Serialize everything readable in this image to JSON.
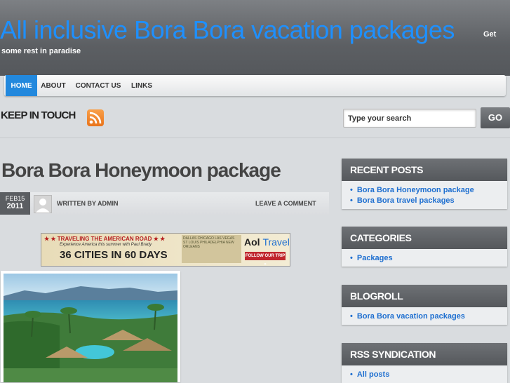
{
  "header": {
    "site_title": "All inclusive Bora Bora vacation packages",
    "tagline_part1": "Get",
    "tagline_part2": "some rest in paradise"
  },
  "nav": {
    "items": [
      {
        "label": "HOME",
        "active": true
      },
      {
        "label": "ABOUT",
        "active": false
      },
      {
        "label": "CONTACT US",
        "active": false
      },
      {
        "label": "LINKS",
        "active": false
      }
    ]
  },
  "keep_in_touch": {
    "label": "KEEP IN TOUCH",
    "search_placeholder": "Type your search",
    "go_label": "GO"
  },
  "post": {
    "title": "Bora Bora Honeymoon package",
    "date_month_day": "FEB15",
    "date_year": "2011",
    "written_by": "WRITTEN BY",
    "author": "ADMIN",
    "leave_comment": "LEAVE A COMMENT"
  },
  "ad": {
    "headline": "TRAVELING THE AMERICAN ROAD",
    "subline": "Experience America this summer with Paul Brady",
    "cities_line": "36 CITIES IN 60 DAYS",
    "map_cities": "DALLAS CHICAGO LAS VEGAS ST LOUIS PHILADELPHIA NEW ORLEANS",
    "brand": "Aol",
    "brand_suffix": "Travel.",
    "cta": "FOLLOW OUR TRIP »"
  },
  "sidebar": {
    "recent_posts": {
      "title": "RECENT POSTS",
      "items": [
        "Bora Bora Honeymoon package",
        "Bora Bora travel packages"
      ]
    },
    "categories": {
      "title": "CATEGORIES",
      "items": [
        "Packages"
      ]
    },
    "blogroll": {
      "title": "BLOGROLL",
      "items": [
        "Bora Bora vacation packages"
      ]
    },
    "rss": {
      "title": "RSS SYNDICATION",
      "items": [
        "All posts"
      ]
    }
  },
  "colors": {
    "accent": "#2288dd",
    "title_blue": "#1e90ff",
    "header_gray": "#5c5f63",
    "link_blue": "#1e6fd0"
  }
}
